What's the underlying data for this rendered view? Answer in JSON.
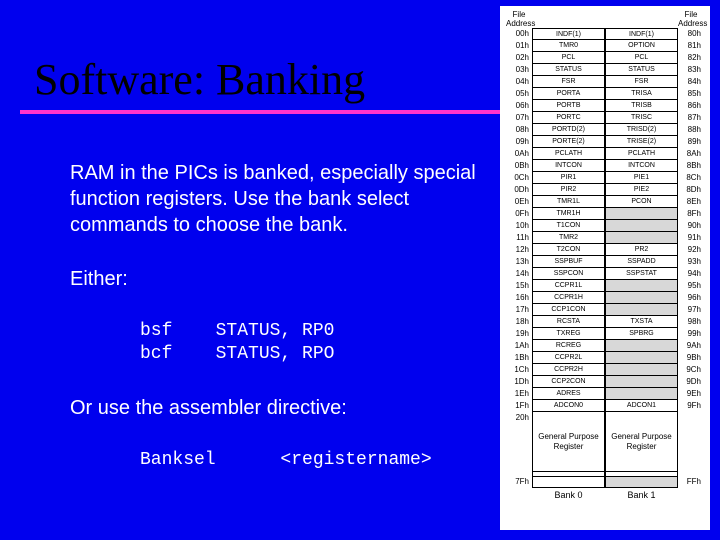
{
  "title": "Software: Banking",
  "para1": "RAM in the PICs is banked, especially special function registers. Use the bank select commands to choose the bank.",
  "either_label": "Either:",
  "code1": "bsf    STATUS, RP0\nbcf    STATUS, RPO",
  "or_label": "Or use the assembler directive:",
  "code2": "Banksel      <registername>",
  "fig": {
    "head_addr": "File\nAddress",
    "rows": [
      {
        "a0": "00h",
        "b0": "INDF(1)",
        "b1": "INDF(1)",
        "a1": "80h"
      },
      {
        "a0": "01h",
        "b0": "TMR0",
        "b1": "OPTION",
        "a1": "81h"
      },
      {
        "a0": "02h",
        "b0": "PCL",
        "b1": "PCL",
        "a1": "82h"
      },
      {
        "a0": "03h",
        "b0": "STATUS",
        "b1": "STATUS",
        "a1": "83h"
      },
      {
        "a0": "04h",
        "b0": "FSR",
        "b1": "FSR",
        "a1": "84h"
      },
      {
        "a0": "05h",
        "b0": "PORTA",
        "b1": "TRISA",
        "a1": "85h"
      },
      {
        "a0": "06h",
        "b0": "PORTB",
        "b1": "TRISB",
        "a1": "86h"
      },
      {
        "a0": "07h",
        "b0": "PORTC",
        "b1": "TRISC",
        "a1": "87h"
      },
      {
        "a0": "08h",
        "b0": "PORTD(2)",
        "b1": "TRISD(2)",
        "a1": "88h"
      },
      {
        "a0": "09h",
        "b0": "PORTE(2)",
        "b1": "TRISE(2)",
        "a1": "89h"
      },
      {
        "a0": "0Ah",
        "b0": "PCLATH",
        "b1": "PCLATH",
        "a1": "8Ah"
      },
      {
        "a0": "0Bh",
        "b0": "INTCON",
        "b1": "INTCON",
        "a1": "8Bh"
      },
      {
        "a0": "0Ch",
        "b0": "PIR1",
        "b1": "PIE1",
        "a1": "8Ch"
      },
      {
        "a0": "0Dh",
        "b0": "PIR2",
        "b1": "PIE2",
        "a1": "8Dh"
      },
      {
        "a0": "0Eh",
        "b0": "TMR1L",
        "b1": "PCON",
        "a1": "8Eh"
      },
      {
        "a0": "0Fh",
        "b0": "TMR1H",
        "b1": "",
        "a1": "8Fh",
        "s1": true
      },
      {
        "a0": "10h",
        "b0": "T1CON",
        "b1": "",
        "a1": "90h",
        "s1": true
      },
      {
        "a0": "11h",
        "b0": "TMR2",
        "b1": "",
        "a1": "91h",
        "s1": true
      },
      {
        "a0": "12h",
        "b0": "T2CON",
        "b1": "PR2",
        "a1": "92h"
      },
      {
        "a0": "13h",
        "b0": "SSPBUF",
        "b1": "SSPADD",
        "a1": "93h"
      },
      {
        "a0": "14h",
        "b0": "SSPCON",
        "b1": "SSPSTAT",
        "a1": "94h"
      },
      {
        "a0": "15h",
        "b0": "CCPR1L",
        "b1": "",
        "a1": "95h",
        "s1": true
      },
      {
        "a0": "16h",
        "b0": "CCPR1H",
        "b1": "",
        "a1": "96h",
        "s1": true
      },
      {
        "a0": "17h",
        "b0": "CCP1CON",
        "b1": "",
        "a1": "97h",
        "s1": true
      },
      {
        "a0": "18h",
        "b0": "RCSTA",
        "b1": "TXSTA",
        "a1": "98h"
      },
      {
        "a0": "19h",
        "b0": "TXREG",
        "b1": "SPBRG",
        "a1": "99h"
      },
      {
        "a0": "1Ah",
        "b0": "RCREG",
        "b1": "",
        "a1": "9Ah",
        "s1": true
      },
      {
        "a0": "1Bh",
        "b0": "CCPR2L",
        "b1": "",
        "a1": "9Bh",
        "s1": true
      },
      {
        "a0": "1Ch",
        "b0": "CCPR2H",
        "b1": "",
        "a1": "9Ch",
        "s1": true
      },
      {
        "a0": "1Dh",
        "b0": "CCP2CON",
        "b1": "",
        "a1": "9Dh",
        "s1": true
      },
      {
        "a0": "1Eh",
        "b0": "ADRES",
        "b1": "",
        "a1": "9Eh",
        "s1": true
      },
      {
        "a0": "1Fh",
        "b0": "ADCON0",
        "b1": "ADCON1",
        "a1": "9Fh"
      }
    ],
    "gpr_a0": "20h",
    "gpr_label": "General\nPurpose\nRegister",
    "gpr_a1": "",
    "last_a0": "7Fh",
    "last_a1": "FFh",
    "bank0": "Bank 0",
    "bank1": "Bank 1"
  }
}
